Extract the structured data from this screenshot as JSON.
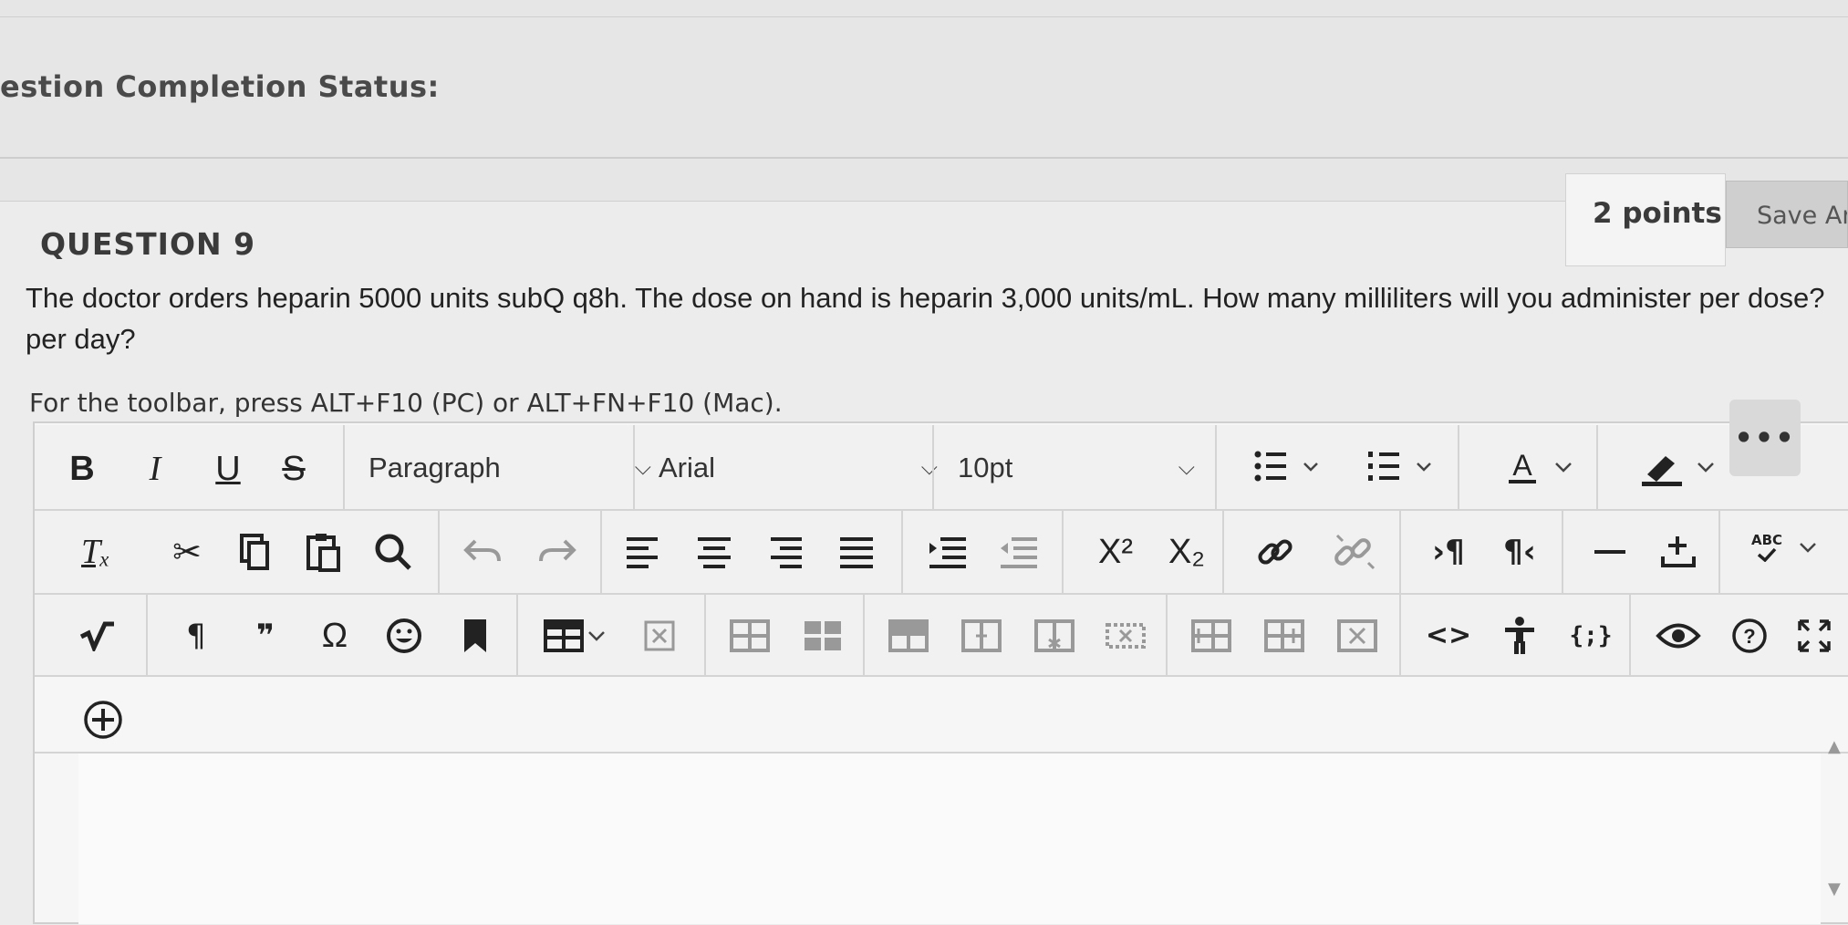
{
  "status": {
    "heading": "estion Completion Status:"
  },
  "question": {
    "title": "QUESTION 9",
    "points": "2 points",
    "save_label": "Save An",
    "text_line1": "The doctor orders heparin 5000 units subQ q8h. The dose on hand is heparin 3,000 units/mL. How many milliliters will you administer per dose?",
    "text_line2": "per day?",
    "toolbar_hint": "For the toolbar, press ALT+F10 (PC) or ALT+FN+F10 (Mac)."
  },
  "toolbar": {
    "bold": "B",
    "italic": "I",
    "underline": "U",
    "strike": "S",
    "paragraph_select": "Paragraph",
    "font_select": "Arial",
    "size_select": "10pt",
    "text_color": "A",
    "more": "•••",
    "superscript": "X²",
    "subscript": "X₂",
    "ltr": "›¶",
    "rtl": "¶‹",
    "spellcheck": "ABC",
    "pilcrow": "¶",
    "quote": "❞",
    "omega": "Ω",
    "html_code": "<>",
    "code_sample": "{;}"
  },
  "colors": {
    "background": "#e6e6e6",
    "toolbar": "#f1f1f1",
    "more_button": "#d9d9d9"
  }
}
